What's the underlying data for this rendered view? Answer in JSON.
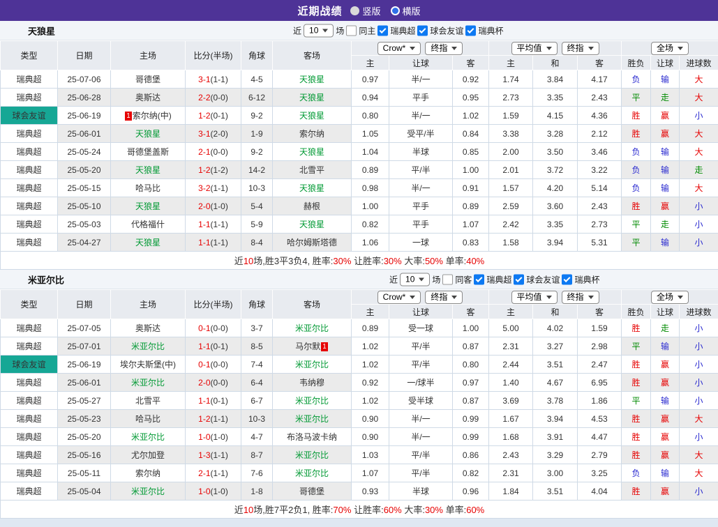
{
  "titlebar": {
    "title": "近期战绩",
    "radios": [
      {
        "label": "竖版",
        "selected": false
      },
      {
        "label": "横版",
        "selected": true
      }
    ]
  },
  "common": {
    "filter": {
      "near": "近",
      "count": "10",
      "unit": "场"
    },
    "leagues": [
      "瑞典超",
      "球会友谊",
      "瑞典杯"
    ],
    "dropdowns": {
      "bookmaker": "Crow*",
      "final": "终指",
      "average": "平均值",
      "final2": "终指",
      "fulltime": "全场"
    },
    "headers": [
      "类型",
      "日期",
      "主场",
      "比分(半场)",
      "角球",
      "客场"
    ],
    "sub_handicap": [
      "主",
      "让球",
      "客"
    ],
    "sub_average": [
      "主",
      "和",
      "客"
    ],
    "sub_result": [
      "胜负",
      "让球",
      "进球数"
    ]
  },
  "colors": {
    "accent_purple": "#4e3397",
    "league_navy": "#15568c",
    "friendly_teal": "#16a795",
    "win_red": "#e60000",
    "team_green": "#009933",
    "draw_green": "#008a00",
    "lose_blue": "#2727cf"
  },
  "sections": [
    {
      "team": "天狼星",
      "filter_same": "同主",
      "rows": [
        {
          "type": "瑞典超",
          "friendly": false,
          "date": "25-07-06",
          "home": "哥德堡",
          "home_hl": false,
          "score": "3-1",
          "half": "(1-1)",
          "corner": "4-5",
          "away": "天狼星",
          "away_hl": true,
          "odds": [
            "0.97",
            "半/一",
            "0.92"
          ],
          "avg": [
            "1.74",
            "3.84",
            "4.17"
          ],
          "results": [
            [
              "负",
              "b"
            ],
            [
              "输",
              "b"
            ],
            [
              "大",
              "r"
            ]
          ]
        },
        {
          "type": "瑞典超",
          "friendly": false,
          "date": "25-06-28",
          "home": "奥斯达",
          "home_hl": false,
          "score": "2-2",
          "half": "(0-0)",
          "corner": "6-12",
          "away": "天狼星",
          "away_hl": true,
          "odds": [
            "0.94",
            "平手",
            "0.95"
          ],
          "avg": [
            "2.73",
            "3.35",
            "2.43"
          ],
          "results": [
            [
              "平",
              "g"
            ],
            [
              "走",
              "g"
            ],
            [
              "大",
              "r"
            ]
          ]
        },
        {
          "type": "球会友谊",
          "friendly": true,
          "date": "25-06-19",
          "home": "索尔纳(中)",
          "home_hl": false,
          "home_badge": "1",
          "home_badge_pos": "pre",
          "score": "1-2",
          "half": "(0-1)",
          "corner": "9-2",
          "away": "天狼星",
          "away_hl": true,
          "odds": [
            "0.80",
            "半/一",
            "1.02"
          ],
          "avg": [
            "1.59",
            "4.15",
            "4.36"
          ],
          "results": [
            [
              "胜",
              "r"
            ],
            [
              "赢",
              "r"
            ],
            [
              "小",
              "b"
            ]
          ]
        },
        {
          "type": "瑞典超",
          "friendly": false,
          "date": "25-06-01",
          "home": "天狼星",
          "home_hl": true,
          "score": "3-1",
          "half": "(2-0)",
          "corner": "1-9",
          "away": "索尔纳",
          "away_hl": false,
          "odds": [
            "1.05",
            "受平/半",
            "0.84"
          ],
          "avg": [
            "3.38",
            "3.28",
            "2.12"
          ],
          "results": [
            [
              "胜",
              "r"
            ],
            [
              "赢",
              "r"
            ],
            [
              "大",
              "r"
            ]
          ]
        },
        {
          "type": "瑞典超",
          "friendly": false,
          "date": "25-05-24",
          "home": "哥德堡盖斯",
          "home_hl": false,
          "score": "2-1",
          "half": "(0-0)",
          "corner": "9-2",
          "away": "天狼星",
          "away_hl": true,
          "odds": [
            "1.04",
            "半球",
            "0.85"
          ],
          "avg": [
            "2.00",
            "3.50",
            "3.46"
          ],
          "results": [
            [
              "负",
              "b"
            ],
            [
              "输",
              "b"
            ],
            [
              "大",
              "r"
            ]
          ]
        },
        {
          "type": "瑞典超",
          "friendly": false,
          "date": "25-05-20",
          "home": "天狼星",
          "home_hl": true,
          "score": "1-2",
          "half": "(1-2)",
          "corner": "14-2",
          "away": "北雪平",
          "away_hl": false,
          "odds": [
            "0.89",
            "平/半",
            "1.00"
          ],
          "avg": [
            "2.01",
            "3.72",
            "3.22"
          ],
          "results": [
            [
              "负",
              "b"
            ],
            [
              "输",
              "b"
            ],
            [
              "走",
              "g"
            ]
          ]
        },
        {
          "type": "瑞典超",
          "friendly": false,
          "date": "25-05-15",
          "home": "哈马比",
          "home_hl": false,
          "score": "3-2",
          "half": "(1-1)",
          "corner": "10-3",
          "away": "天狼星",
          "away_hl": true,
          "odds": [
            "0.98",
            "半/一",
            "0.91"
          ],
          "avg": [
            "1.57",
            "4.20",
            "5.14"
          ],
          "results": [
            [
              "负",
              "b"
            ],
            [
              "输",
              "b"
            ],
            [
              "大",
              "r"
            ]
          ]
        },
        {
          "type": "瑞典超",
          "friendly": false,
          "date": "25-05-10",
          "home": "天狼星",
          "home_hl": true,
          "score": "2-0",
          "half": "(1-0)",
          "corner": "5-4",
          "away": "赫根",
          "away_hl": false,
          "odds": [
            "1.00",
            "平手",
            "0.89"
          ],
          "avg": [
            "2.59",
            "3.60",
            "2.43"
          ],
          "results": [
            [
              "胜",
              "r"
            ],
            [
              "赢",
              "r"
            ],
            [
              "小",
              "b"
            ]
          ]
        },
        {
          "type": "瑞典超",
          "friendly": false,
          "date": "25-05-03",
          "home": "代格福什",
          "home_hl": false,
          "score": "1-1",
          "half": "(1-1)",
          "corner": "5-9",
          "away": "天狼星",
          "away_hl": true,
          "odds": [
            "0.82",
            "平手",
            "1.07"
          ],
          "avg": [
            "2.42",
            "3.35",
            "2.73"
          ],
          "results": [
            [
              "平",
              "g"
            ],
            [
              "走",
              "g"
            ],
            [
              "小",
              "b"
            ]
          ]
        },
        {
          "type": "瑞典超",
          "friendly": false,
          "date": "25-04-27",
          "home": "天狼星",
          "home_hl": true,
          "score": "1-1",
          "half": "(1-1)",
          "corner": "8-4",
          "away": "哈尔姆斯塔德",
          "away_hl": false,
          "odds": [
            "1.06",
            "一球",
            "0.83"
          ],
          "avg": [
            "1.58",
            "3.94",
            "5.31"
          ],
          "results": [
            [
              "平",
              "g"
            ],
            [
              "输",
              "b"
            ],
            [
              "小",
              "b"
            ]
          ]
        }
      ],
      "summary": [
        {
          "t": "近",
          "c": "k"
        },
        {
          "t": "10",
          "c": "r"
        },
        {
          "t": "场,胜3平3负4, 胜率:",
          "c": "k"
        },
        {
          "t": "30%",
          "c": "r"
        },
        {
          "t": " 让胜率:",
          "c": "k"
        },
        {
          "t": "30%",
          "c": "r"
        },
        {
          "t": " 大率:",
          "c": "k"
        },
        {
          "t": "50%",
          "c": "r"
        },
        {
          "t": " 单率:",
          "c": "k"
        },
        {
          "t": "40%",
          "c": "r"
        }
      ]
    },
    {
      "team": "米亚尔比",
      "filter_same": "同客",
      "rows": [
        {
          "type": "瑞典超",
          "friendly": false,
          "date": "25-07-05",
          "home": "奥斯达",
          "home_hl": false,
          "score": "0-1",
          "half": "(0-0)",
          "corner": "3-7",
          "away": "米亚尔比",
          "away_hl": true,
          "odds": [
            "0.89",
            "受一球",
            "1.00"
          ],
          "avg": [
            "5.00",
            "4.02",
            "1.59"
          ],
          "results": [
            [
              "胜",
              "r"
            ],
            [
              "走",
              "g"
            ],
            [
              "小",
              "b"
            ]
          ]
        },
        {
          "type": "瑞典超",
          "friendly": false,
          "date": "25-07-01",
          "home": "米亚尔比",
          "home_hl": true,
          "score": "1-1",
          "half": "(0-1)",
          "corner": "8-5",
          "away": "马尔默",
          "away_hl": false,
          "away_badge": "1",
          "away_badge_pos": "post",
          "odds": [
            "1.02",
            "平/半",
            "0.87"
          ],
          "avg": [
            "2.31",
            "3.27",
            "2.98"
          ],
          "results": [
            [
              "平",
              "g"
            ],
            [
              "输",
              "b"
            ],
            [
              "小",
              "b"
            ]
          ]
        },
        {
          "type": "球会友谊",
          "friendly": true,
          "date": "25-06-19",
          "home": "埃尔夫斯堡(中)",
          "home_hl": false,
          "score": "0-1",
          "half": "(0-0)",
          "corner": "7-4",
          "away": "米亚尔比",
          "away_hl": true,
          "odds": [
            "1.02",
            "平/半",
            "0.80"
          ],
          "avg": [
            "2.44",
            "3.51",
            "2.47"
          ],
          "results": [
            [
              "胜",
              "r"
            ],
            [
              "赢",
              "r"
            ],
            [
              "小",
              "b"
            ]
          ]
        },
        {
          "type": "瑞典超",
          "friendly": false,
          "date": "25-06-01",
          "home": "米亚尔比",
          "home_hl": true,
          "score": "2-0",
          "half": "(0-0)",
          "corner": "6-4",
          "away": "韦纳穆",
          "away_hl": false,
          "odds": [
            "0.92",
            "一/球半",
            "0.97"
          ],
          "avg": [
            "1.40",
            "4.67",
            "6.95"
          ],
          "results": [
            [
              "胜",
              "r"
            ],
            [
              "赢",
              "r"
            ],
            [
              "小",
              "b"
            ]
          ]
        },
        {
          "type": "瑞典超",
          "friendly": false,
          "date": "25-05-27",
          "home": "北雪平",
          "home_hl": false,
          "score": "1-1",
          "half": "(0-1)",
          "corner": "6-7",
          "away": "米亚尔比",
          "away_hl": true,
          "odds": [
            "1.02",
            "受半球",
            "0.87"
          ],
          "avg": [
            "3.69",
            "3.78",
            "1.86"
          ],
          "results": [
            [
              "平",
              "g"
            ],
            [
              "输",
              "b"
            ],
            [
              "小",
              "b"
            ]
          ]
        },
        {
          "type": "瑞典超",
          "friendly": false,
          "date": "25-05-23",
          "home": "哈马比",
          "home_hl": false,
          "score": "1-2",
          "half": "(1-1)",
          "corner": "10-3",
          "away": "米亚尔比",
          "away_hl": true,
          "odds": [
            "0.90",
            "半/一",
            "0.99"
          ],
          "avg": [
            "1.67",
            "3.94",
            "4.53"
          ],
          "results": [
            [
              "胜",
              "r"
            ],
            [
              "赢",
              "r"
            ],
            [
              "大",
              "r"
            ]
          ]
        },
        {
          "type": "瑞典超",
          "friendly": false,
          "date": "25-05-20",
          "home": "米亚尔比",
          "home_hl": true,
          "score": "1-0",
          "half": "(1-0)",
          "corner": "4-7",
          "away": "布洛马波卡纳",
          "away_hl": false,
          "odds": [
            "0.90",
            "半/一",
            "0.99"
          ],
          "avg": [
            "1.68",
            "3.91",
            "4.47"
          ],
          "results": [
            [
              "胜",
              "r"
            ],
            [
              "赢",
              "r"
            ],
            [
              "小",
              "b"
            ]
          ]
        },
        {
          "type": "瑞典超",
          "friendly": false,
          "date": "25-05-16",
          "home": "尤尔加登",
          "home_hl": false,
          "score": "1-3",
          "half": "(1-1)",
          "corner": "8-7",
          "away": "米亚尔比",
          "away_hl": true,
          "odds": [
            "1.03",
            "平/半",
            "0.86"
          ],
          "avg": [
            "2.43",
            "3.29",
            "2.79"
          ],
          "results": [
            [
              "胜",
              "r"
            ],
            [
              "赢",
              "r"
            ],
            [
              "大",
              "r"
            ]
          ]
        },
        {
          "type": "瑞典超",
          "friendly": false,
          "date": "25-05-11",
          "home": "索尔纳",
          "home_hl": false,
          "score": "2-1",
          "half": "(1-1)",
          "corner": "7-6",
          "away": "米亚尔比",
          "away_hl": true,
          "odds": [
            "1.07",
            "平/半",
            "0.82"
          ],
          "avg": [
            "2.31",
            "3.00",
            "3.25"
          ],
          "results": [
            [
              "负",
              "b"
            ],
            [
              "输",
              "b"
            ],
            [
              "大",
              "r"
            ]
          ]
        },
        {
          "type": "瑞典超",
          "friendly": false,
          "date": "25-05-04",
          "home": "米亚尔比",
          "home_hl": true,
          "score": "1-0",
          "half": "(1-0)",
          "corner": "1-8",
          "away": "哥德堡",
          "away_hl": false,
          "odds": [
            "0.93",
            "半球",
            "0.96"
          ],
          "avg": [
            "1.84",
            "3.51",
            "4.04"
          ],
          "results": [
            [
              "胜",
              "r"
            ],
            [
              "赢",
              "r"
            ],
            [
              "小",
              "b"
            ]
          ]
        }
      ],
      "summary": [
        {
          "t": "近",
          "c": "k"
        },
        {
          "t": "10",
          "c": "r"
        },
        {
          "t": "场,胜7平2负1, 胜率:",
          "c": "k"
        },
        {
          "t": "70%",
          "c": "r"
        },
        {
          "t": " 让胜率:",
          "c": "k"
        },
        {
          "t": "60%",
          "c": "r"
        },
        {
          "t": " 大率:",
          "c": "k"
        },
        {
          "t": "30%",
          "c": "r"
        },
        {
          "t": " 单率:",
          "c": "k"
        },
        {
          "t": "60%",
          "c": "r"
        }
      ]
    }
  ]
}
